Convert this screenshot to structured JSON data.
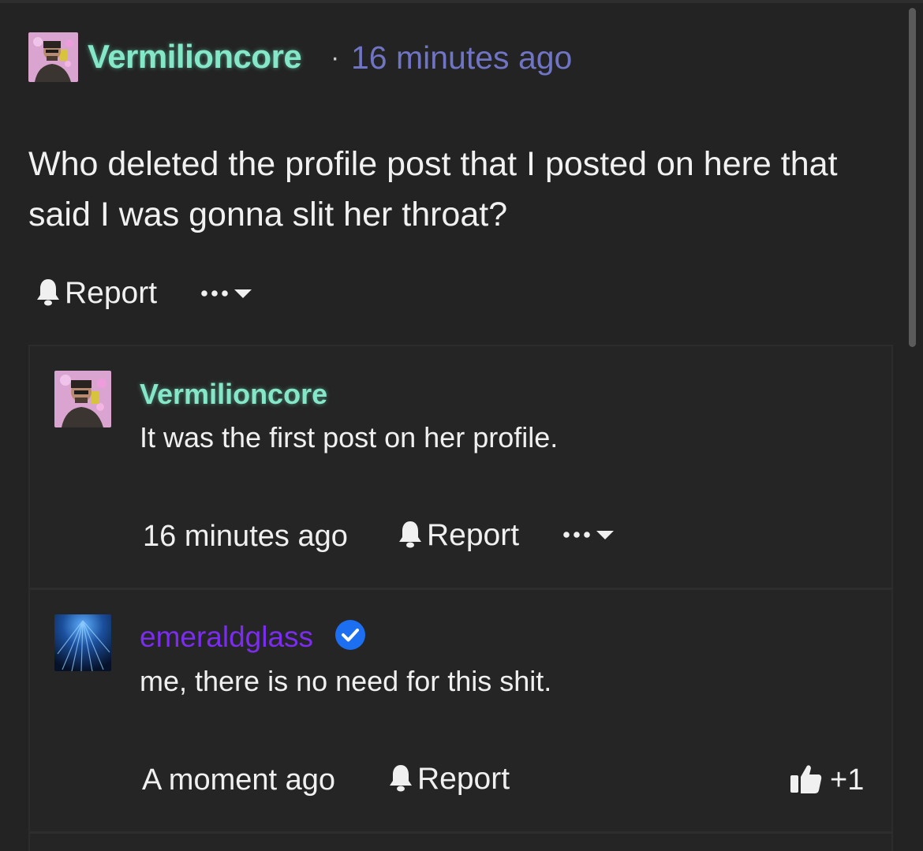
{
  "post": {
    "username": "Vermilioncore",
    "separator": "·",
    "timestamp": "16 minutes ago",
    "body": "Who deleted the profile post that I posted on here that said I was gonna slit her throat?",
    "report_label": "Report"
  },
  "replies": [
    {
      "username": "Vermilioncore",
      "text": "It was the first post on her profile.",
      "timestamp": "16 minutes ago",
      "report_label": "Report"
    },
    {
      "username": "emeraldglass",
      "verified": true,
      "text": "me, there is no need for this shit.",
      "timestamp": "A moment ago",
      "report_label": "Report",
      "likes": "+1"
    }
  ],
  "icons": {
    "report": "bell-icon",
    "more": "ellipsis-icon",
    "dropdown": "chevron-down-icon",
    "verified": "verified-check-icon",
    "like": "thumbs-up-icon"
  },
  "colors": {
    "background": "#232323",
    "username_glow": "#86e6c8",
    "timestamp_link": "#7074c4",
    "username_purple": "#7b2cf0",
    "verified_blue": "#1d6ff2"
  }
}
